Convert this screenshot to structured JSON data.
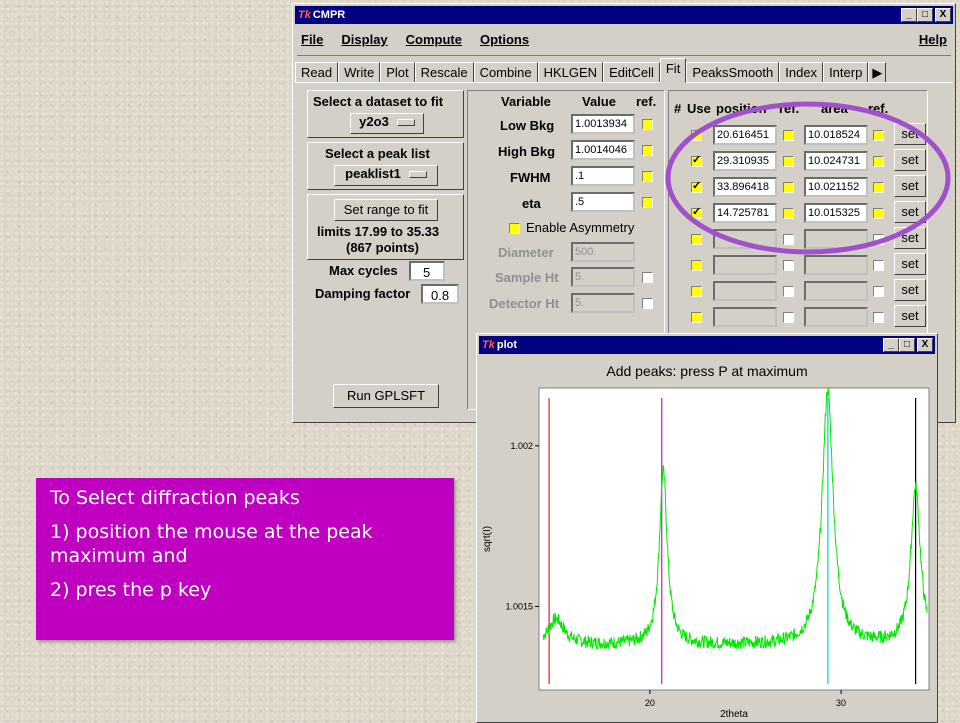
{
  "cmpr_window": {
    "title": "CMPR",
    "tk_icon": "Tk",
    "window_buttons": [
      "_",
      "□",
      "X"
    ],
    "menu": [
      "File",
      "Display",
      "Compute",
      "Options"
    ],
    "help": "Help",
    "tabs": [
      "Read",
      "Write",
      "Plot",
      "Rescale",
      "Combine",
      "HKLGEN",
      "EditCell",
      "Fit",
      "PeaksSmooth",
      "Index",
      "Interp"
    ],
    "active_tab": "Fit",
    "tab_scroll_icon": "triangle-right-icon",
    "left": {
      "select_dataset_label": "Select a dataset to fit",
      "dataset_value": "y2o3",
      "select_peaklist_label": "Select a peak list",
      "peaklist_value": "peaklist1",
      "set_range_button": "Set range to fit",
      "limits_text": "limits 17.99 to 35.33",
      "points_text": "(867 points)",
      "max_cycles_label": "Max cycles",
      "max_cycles_value": "5",
      "damping_label": "Damping factor",
      "damping_value": "0.8",
      "run_button": "Run GPLSFT"
    },
    "params": {
      "headers": [
        "Variable",
        "Value",
        "ref."
      ],
      "rows": [
        {
          "label": "Low Bkg",
          "value": "1.0013934"
        },
        {
          "label": "High Bkg",
          "value": "1.0014046"
        },
        {
          "label": "FWHM",
          "value": ".1"
        },
        {
          "label": "eta",
          "value": ".5"
        }
      ],
      "asymmetry_label": "Enable Asymmetry",
      "disabled_rows": [
        {
          "label": "Diameter",
          "value": "500."
        },
        {
          "label": "Sample Ht",
          "value": "5."
        },
        {
          "label": "Detector Ht",
          "value": "5."
        }
      ]
    },
    "peaks": {
      "headers": [
        "#",
        "Use",
        "position",
        "ref.",
        "area",
        "ref."
      ],
      "rows": [
        {
          "position": "20.616451",
          "area": "10.018524",
          "set": "set"
        },
        {
          "position": "29.310935",
          "area": "10.024731",
          "set": "set"
        },
        {
          "position": "33.896418",
          "area": "10.021152",
          "set": "set"
        },
        {
          "position": "14.725781",
          "area": "10.015325",
          "set": "set"
        },
        {
          "position": "",
          "area": "",
          "set": "set"
        },
        {
          "position": "",
          "area": "",
          "set": "set"
        },
        {
          "position": "",
          "area": "",
          "set": "set"
        },
        {
          "position": "",
          "area": "",
          "set": "set"
        }
      ]
    }
  },
  "plot_window": {
    "title": "plot",
    "window_buttons": [
      "_",
      "□",
      "X"
    ],
    "chart_data": {
      "type": "line",
      "title": "Add peaks: press P at maximum",
      "xlabel": "2theta",
      "ylabel": "sqrt(I)",
      "xlim": [
        14.2,
        34.6
      ],
      "ylim": [
        1.00124,
        1.00218
      ],
      "xticks": [
        20,
        30
      ],
      "yticks": [
        1.0015,
        1.002
      ],
      "ytick_labels": [
        "1.0015",
        "1.002"
      ],
      "series": [
        {
          "color": "#00e800",
          "background": 1.00138,
          "peaks": [
            {
              "x": 15.1,
              "height": 8e-05,
              "width": 0.5
            },
            {
              "x": 20.7,
              "height": 0.00054,
              "width": 0.25
            },
            {
              "x": 29.3,
              "height": 0.00079,
              "width": 0.35
            },
            {
              "x": 33.9,
              "height": 0.00049,
              "width": 0.3
            }
          ]
        }
      ],
      "markers": [
        {
          "x": 14.73,
          "color": "#e02020"
        },
        {
          "x": 20.62,
          "color": "#c020c0"
        },
        {
          "x": 29.31,
          "color": "#00d0d0"
        },
        {
          "x": 33.9,
          "color": "#000000"
        }
      ]
    }
  },
  "note": {
    "line1": "To Select diffraction peaks",
    "line2": "1) position the mouse at the peak maximum and",
    "line3": "2) pres the p key",
    "color": "#c000c0"
  }
}
